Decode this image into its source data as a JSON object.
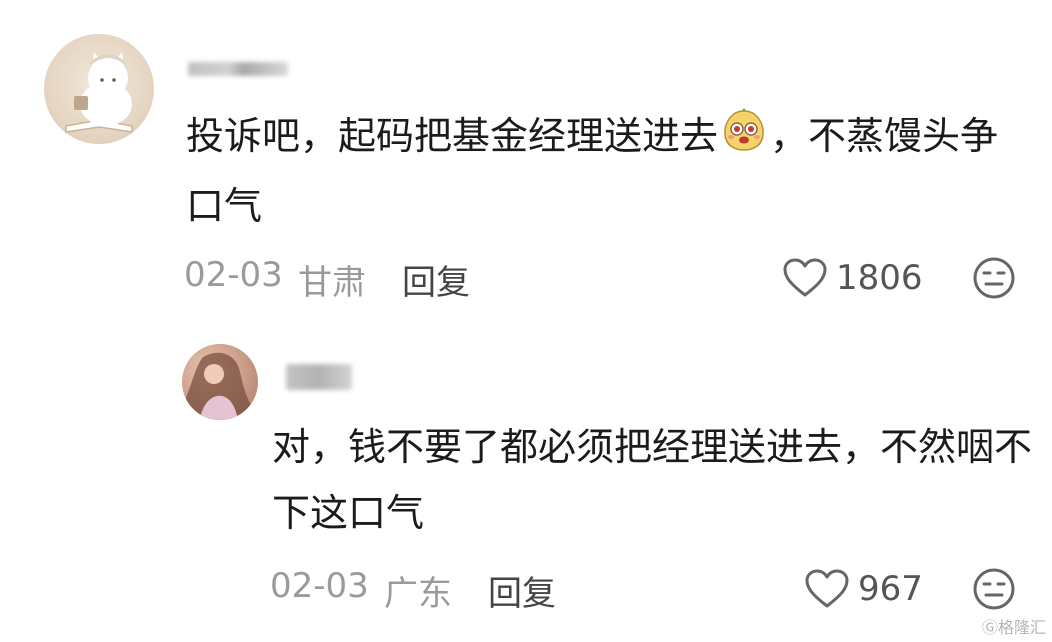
{
  "comments": [
    {
      "text_before_emoji": "投诉吧，起码把基金经理送进去",
      "emoji": "smiling-bun-emoji",
      "text_after_emoji": "，不蒸馒头争口气",
      "date": "02-03",
      "location": "甘肃",
      "reply_label": "回复",
      "likes": "1806",
      "reaction_icon": "neutral-face-icon"
    },
    {
      "text": "对，钱不要了都必须把经理送进去，不然咽不下这口气",
      "date": "02-03",
      "location": "广东",
      "reply_label": "回复",
      "likes": "967",
      "reaction_icon": "neutral-face-icon"
    }
  ],
  "watermark": "格隆汇",
  "colors": {
    "text": "#1b1b1b",
    "meta": "#9a9a9a",
    "reply": "#444444",
    "icon_stroke": "#666666"
  }
}
